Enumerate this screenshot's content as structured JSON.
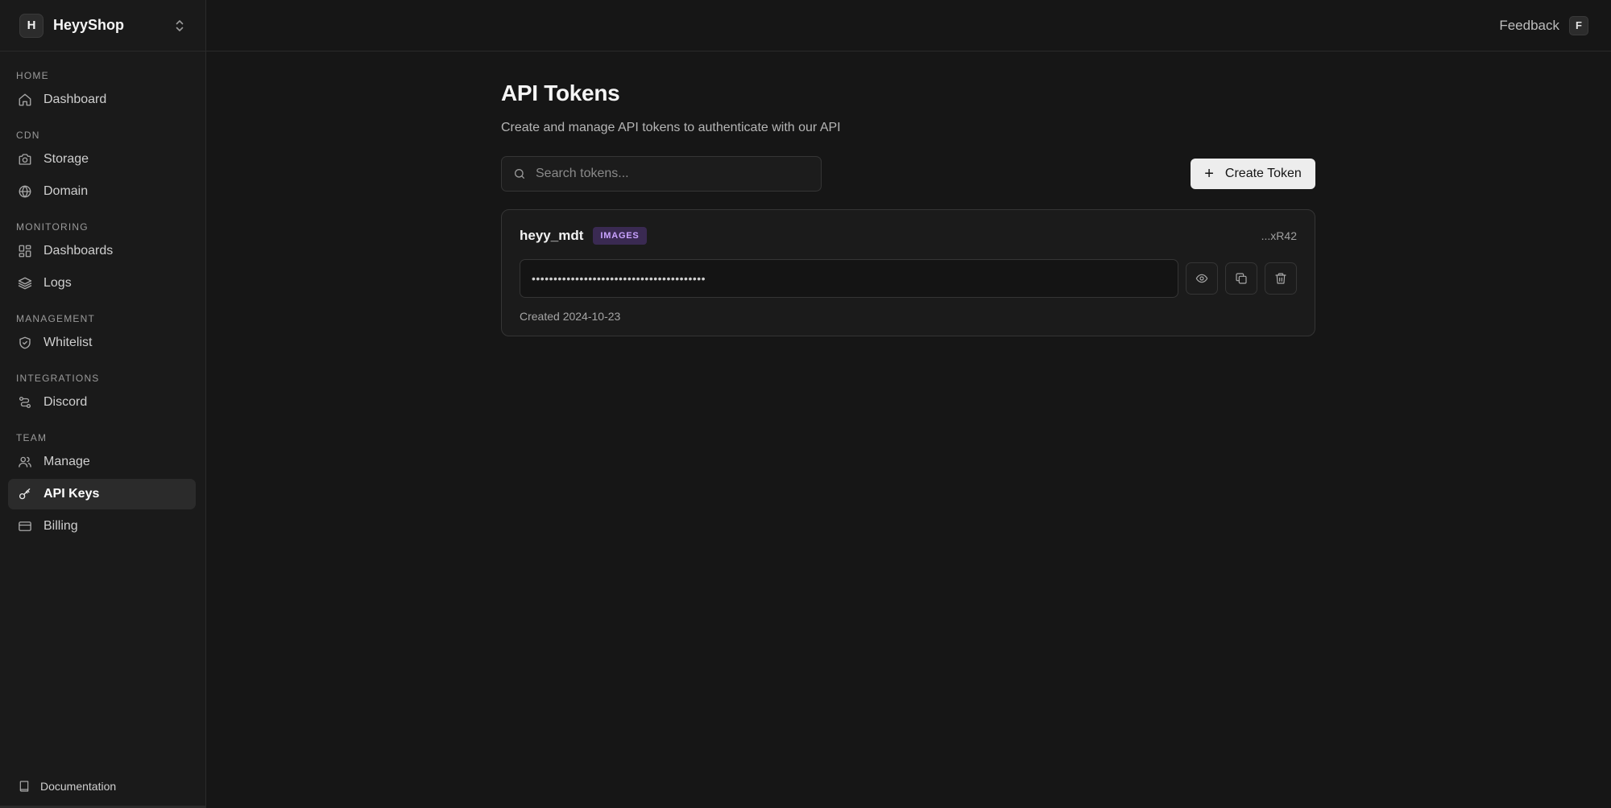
{
  "workspace": {
    "initial": "H",
    "name": "HeyyShop"
  },
  "sidebar": {
    "sections": [
      {
        "title": "HOME",
        "items": [
          {
            "label": "Dashboard",
            "icon": "home-icon"
          }
        ]
      },
      {
        "title": "CDN",
        "items": [
          {
            "label": "Storage",
            "icon": "camera-icon"
          },
          {
            "label": "Domain",
            "icon": "globe-icon"
          }
        ]
      },
      {
        "title": "MONITORING",
        "items": [
          {
            "label": "Dashboards",
            "icon": "layout-dashboard-icon"
          },
          {
            "label": "Logs",
            "icon": "layers-icon"
          }
        ]
      },
      {
        "title": "MANAGEMENT",
        "items": [
          {
            "label": "Whitelist",
            "icon": "shield-check-icon"
          }
        ]
      },
      {
        "title": "INTEGRATIONS",
        "items": [
          {
            "label": "Discord",
            "icon": "route-icon"
          }
        ]
      },
      {
        "title": "TEAM",
        "items": [
          {
            "label": "Manage",
            "icon": "users-icon"
          },
          {
            "label": "API Keys",
            "icon": "key-icon",
            "active": true
          },
          {
            "label": "Billing",
            "icon": "credit-card-icon"
          }
        ]
      }
    ],
    "documentation_label": "Documentation"
  },
  "topbar": {
    "feedback_label": "Feedback",
    "feedback_shortcut": "F"
  },
  "page": {
    "title": "API Tokens",
    "subtitle": "Create and manage API tokens to authenticate with our API"
  },
  "search": {
    "placeholder": "Search tokens...",
    "value": ""
  },
  "create_button": {
    "label": "Create Token"
  },
  "tokens": [
    {
      "name": "heyy_mdt",
      "badge": "IMAGES",
      "suffix": "...xR42",
      "masked_value": "••••••••••••••••••••••••••••••••••••••••",
      "created": "Created 2024-10-23"
    }
  ],
  "colors": {
    "background": "#161616",
    "sidebar": "#1a1a1a",
    "badge_bg": "#3a2a52",
    "badge_text": "#c9a3ff",
    "primary_button": "#ededed"
  }
}
